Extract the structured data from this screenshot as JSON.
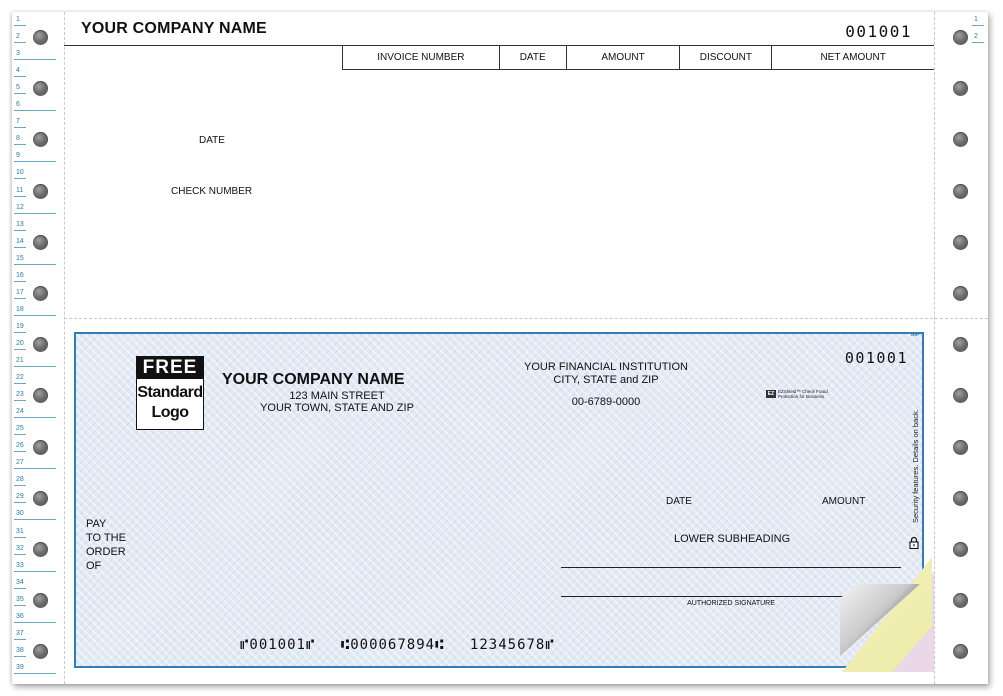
{
  "stub": {
    "company_name": "YOUR COMPANY NAME",
    "check_number": "001001",
    "table_headers": [
      "INVOICE NUMBER",
      "DATE",
      "AMOUNT",
      "DISCOUNT",
      "NET AMOUNT"
    ],
    "date_label": "DATE",
    "check_number_label": "CHECK NUMBER"
  },
  "line_numbers_left": [
    "1",
    "2",
    "3",
    "4",
    "5",
    "6",
    "7",
    "8",
    "9",
    "10",
    "11",
    "12",
    "13",
    "14",
    "15",
    "16",
    "17",
    "18",
    "19",
    "20",
    "21",
    "22",
    "23",
    "24",
    "25",
    "26",
    "27",
    "28",
    "29",
    "30",
    "31",
    "32",
    "33",
    "34",
    "35",
    "36",
    "37",
    "38",
    "39"
  ],
  "line_numbers_right": [
    "1",
    "2"
  ],
  "check": {
    "mp_mark": "MP",
    "logo": {
      "top": "FREE",
      "line1": "Standard",
      "line2": "Logo"
    },
    "company_name": "YOUR COMPANY NAME",
    "address_line1": "123 MAIN STREET",
    "address_line2": "YOUR TOWN, STATE AND ZIP",
    "bank_name": "YOUR FINANCIAL INSTITUTION",
    "bank_city": "CITY, STATE and ZIP",
    "routing_fraction": "00-6789-0000",
    "check_number": "001001",
    "ezshield_badge": "EZ",
    "ezshield_line1": "EZShield™ Check Fraud",
    "ezshield_line2": "Protection for Business",
    "security_text": "Security features. Details on back.",
    "pay_to_lines": [
      "PAY",
      "TO THE",
      "ORDER",
      "OF"
    ],
    "date_label": "DATE",
    "amount_label": "AMOUNT",
    "lower_subheading": "LOWER SUBHEADING",
    "signature_label": "AUTHORIZED SIGNATURE",
    "micr_check": "⑈001001⑈",
    "micr_routing": "⑆000067894⑆",
    "micr_account": "12345678⑈"
  },
  "colors": {
    "check_border": "#2f7fb5",
    "check_background": "#e3e9f5",
    "line_number": "#2a7fa0"
  }
}
